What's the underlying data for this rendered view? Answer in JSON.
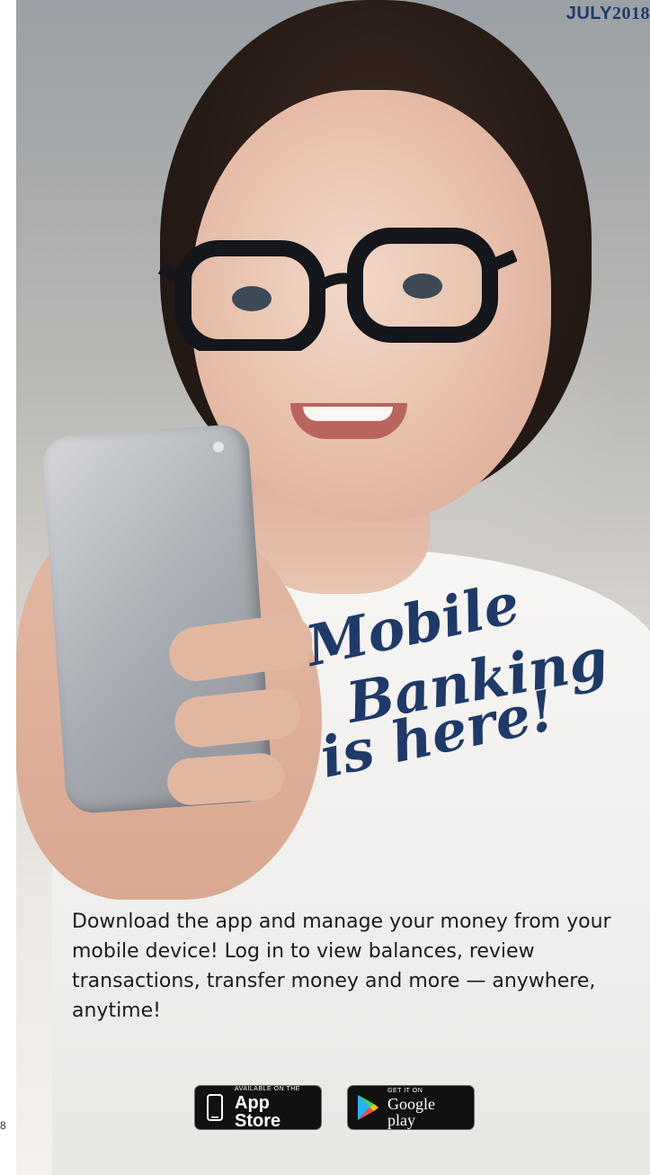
{
  "page": {
    "number": "8",
    "date_month": "JULY",
    "date_year": "2018"
  },
  "headline": {
    "line1": "Mobile",
    "line2": "Banking",
    "line3": "is here!"
  },
  "body": {
    "text": "Download the app and manage your money from your mobile device! Log in to view balances, review transactions, transfer money and more — anywhere, anytime!"
  },
  "badges": {
    "apple_small": "AVAILABLE ON THE",
    "apple_big": "App Store",
    "google_small": "GET IT ON",
    "google_big": "Google play"
  },
  "colors": {
    "accent": "#1f3a68",
    "badge_background": "#111111"
  },
  "icons": [
    "phone-device-icon",
    "google-play-icon"
  ]
}
